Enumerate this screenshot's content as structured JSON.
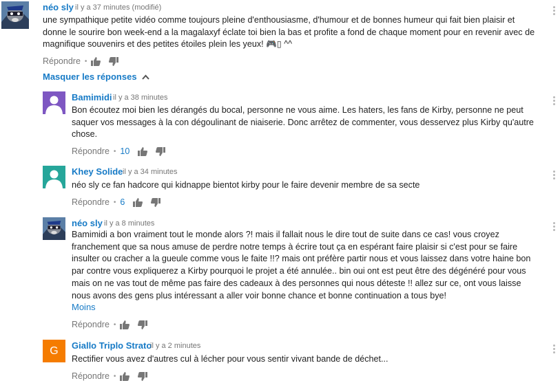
{
  "main_comment": {
    "author": "néo sly",
    "time": "il y a 37 minutes (modifié)",
    "lines": [
      "une sympathique petite vidéo comme toujours pleine d'enthousiasme, d'humour et de bonnes humeur qui fait bien plaisir et",
      "donne le sourire bon week-end a la magalaxyf éclate toi bien la bas et profite a fond de chaque moment pour en revenir avec de",
      "magnifique souvenirs et des petites étoiles plein les yeux! 🎮▯ ^^"
    ],
    "reply_label": "Répondre",
    "hide_replies_label": "Masquer les réponses"
  },
  "replies": [
    {
      "author": "Bamimidi",
      "time": "il y a 38 minutes",
      "lines": [
        "Bon écoutez moi bien les dérangés du bocal, personne ne vous aime. Les haters, les fans de Kirby, personne ne peut",
        "saquer vos messages à la con dégoulinant de niaiserie. Donc arrêtez de commenter, vous desservez plus Kirby qu'autre",
        "chose."
      ],
      "reply_label": "Répondre",
      "likes": "10",
      "avatar_color": "#7e57c2"
    },
    {
      "author": "Khey Solide",
      "time": "il y a 34 minutes",
      "lines": [
        "néo sly ce fan hadcore qui  kidnappe bientot kirby pour le faire devenir membre de sa secte"
      ],
      "reply_label": "Répondre",
      "likes": "6",
      "avatar_color": "#26a69a"
    },
    {
      "author": "néo sly",
      "time": "il y a 8 minutes",
      "lines": [
        "Bamimidi a bon vraiment tout le monde alors ?! mais il fallait nous le dire tout de suite dans ce cas! vous croyez",
        "franchement que sa nous amuse de perdre notre temps à écrire tout ça en espérant faire plaisir si c'est pour se faire",
        "insulter ou cracher a la gueule comme vous le faite !!? mais ont préfère partir nous et vous laissez dans votre haine bon",
        "par contre vous expliquerez a Kirby pourquoi le projet a été annulée.. bin oui ont est peut être des dégénéré pour vous",
        "mais on ne vas tout de même pas faire des cadeaux à des personnes qui nous déteste !! allez sur ce, ont vous laisse",
        "nous avons des gens plus intéressant a aller voir bonne chance et bonne continuation a tous bye!"
      ],
      "less_label": "Moins",
      "reply_label": "Répondre"
    },
    {
      "author": "Giallo Triplo Strato",
      "time": "il y a 2 minutes",
      "lines": [
        "Rectifier vous avez d'autres cul à lécher pour vous sentir vivant bande de déchet..."
      ],
      "reply_label": "Répondre",
      "avatar_letter": "G",
      "avatar_color": "#f57c00"
    }
  ],
  "colors": {
    "link": "#167ac6",
    "meta": "#767676"
  }
}
